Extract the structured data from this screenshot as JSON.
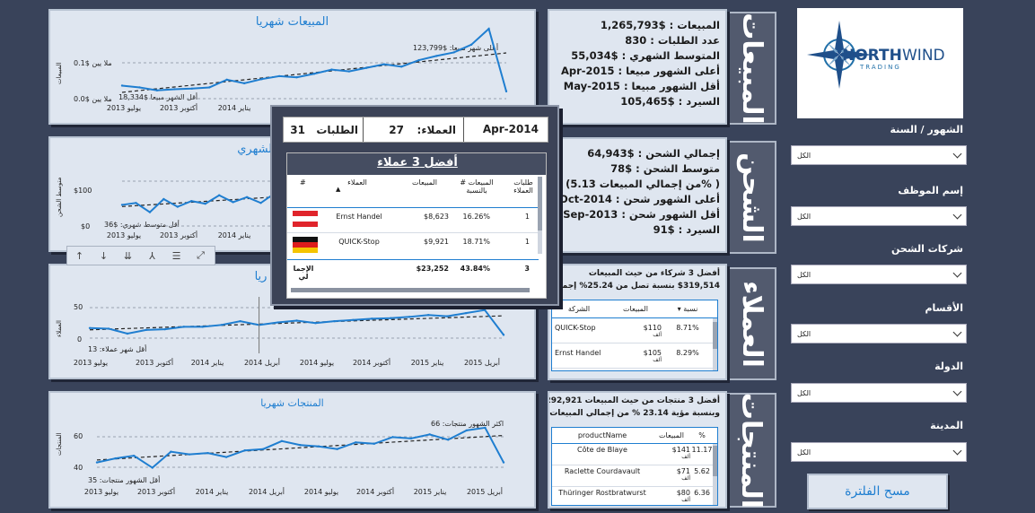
{
  "logo": {
    "brand_left": "NORTH",
    "brand_right": "WIND",
    "brand_sub": "TRADING"
  },
  "filters": [
    {
      "label": "الشهور / السنة",
      "value": "الكل"
    },
    {
      "label": "إسم الموظف",
      "value": "الكل"
    },
    {
      "label": "شركات الشحن",
      "value": "الكل"
    },
    {
      "label": "الأقسام",
      "value": "الكل"
    },
    {
      "label": "الدولة",
      "value": "الكل"
    },
    {
      "label": "المدينة",
      "value": "الكل"
    }
  ],
  "clear_button": "مسح الفلترة",
  "section_labels": [
    "المبيعات",
    "الشحن",
    "العملاء",
    "المنتجات"
  ],
  "sales_kpis": [
    "المبيعات : $1,265,793",
    "عدد الطلبات : 830",
    "المتوسط الشهري : $55,034",
    "أعلى الشهور مبيعا : Apr-2015",
    "أقل الشهور مبيعا : May-2015",
    "السيرد : $105,465"
  ],
  "shipping_kpis": [
    "إجمالي الشحن : $64,943",
    "متوسط الشحن : $78",
    "( %من إجمالي المبيعات 5.13)",
    "أعلى الشهور شحن : Oct-2014",
    "أقل الشهور شحن : Sep-2013",
    "السيرد : $91"
  ],
  "customers_block": {
    "line1": "أفضل 3 شركاء من حيث المبيعات",
    "line2": "$319,514 بنسبة تصل من 25.24% إجمالي",
    "headers": [
      "نسبة",
      "المبيعات",
      "الشركة"
    ],
    "rows": [
      {
        "pct": "8.71%",
        "sales": "$110",
        "unit": "ألف",
        "company": "QUICK-Stop"
      },
      {
        "pct": "8.29%",
        "sales": "$105",
        "unit": "ألف",
        "company": "Ernst Handel"
      }
    ]
  },
  "products_block": {
    "line1": "أفضل 3 منتجات من حيث المبيعات 292,921",
    "line2": "وبنسبة مؤية 23.14 % من إجمالي المبيعات",
    "headers": [
      "%",
      "المبيعات",
      "productName"
    ],
    "rows": [
      {
        "pct": "11.17",
        "sales": "$141",
        "unit": "ألف",
        "name": "Côte de Blaye"
      },
      {
        "pct": "5.62",
        "sales": "$71",
        "unit": "ألف",
        "name": "Raclette Courdavault"
      },
      {
        "pct": "6.36",
        "sales": "$80",
        "unit": "ألف",
        "name": "Thüringer Rostbratwurst"
      }
    ]
  },
  "x_ticks_chart1": [
    "يوليو 2013",
    "أكتوبر 2013",
    "يناير 2014"
  ],
  "x_ticks_full": [
    "يوليو 2013",
    "أكتوبر 2013",
    "يناير 2014",
    "أبريل 2014",
    "يوليو 2014",
    "أكتوبر 2014",
    "يناير 2015",
    "أبريل 2015"
  ],
  "x_ticks_chart2": [
    "يوليو 2013",
    "أكتوبر 2013",
    "يناير 2014"
  ],
  "charts": {
    "sales": {
      "title": "المبيعات شهريا",
      "ylabel": "المبيعات",
      "yticks": [
        "ملا يين $0.1",
        "ملا يين $0.0"
      ],
      "ann_max": "أعلى شهر مبيعا: $123,799",
      "ann_min": "أقل الشهر مبيعا $18,334"
    },
    "shipping": {
      "title": "الشهري",
      "ylabel": "متوسط الشحن",
      "yticks": [
        "$100",
        "$0"
      ],
      "ann_min": "أقل متوسط شهري: $36"
    },
    "customers": {
      "title": "ريا",
      "ylabel": "العملاء",
      "yticks": [
        "50",
        "0"
      ],
      "ann_min": "أقل شهر عملاء: 13"
    },
    "products": {
      "title": "المنتجات شهريا",
      "ylabel": "المنتجات",
      "yticks": [
        "60",
        "40"
      ],
      "ann_max": "اكثر الشهور منتجات: 66",
      "ann_min": "أقل الشهور منتجات: 35"
    }
  },
  "chart_data": [
    {
      "type": "line",
      "title": "المبيعات شهريا",
      "x": [
        "Jul-2013",
        "Aug-2013",
        "Sep-2013",
        "Oct-2013",
        "Nov-2013",
        "Dec-2013",
        "Jan-2014",
        "Feb-2014",
        "Mar-2014",
        "Apr-2014",
        "May-2014",
        "Jun-2014",
        "Jul-2014",
        "Aug-2014",
        "Sep-2014",
        "Oct-2014",
        "Nov-2014",
        "Dec-2014",
        "Jan-2015",
        "Feb-2015",
        "Mar-2015",
        "Apr-2015",
        "May-2015"
      ],
      "series": [
        {
          "values": [
            28000,
            25000,
            20000,
            22000,
            23000,
            25000,
            38000,
            32000,
            39000,
            44000,
            42000,
            48000,
            55000,
            52000,
            58000,
            64000,
            60000,
            71000,
            78000,
            84000,
            97000,
            123799,
            18334
          ]
        }
      ],
      "ylim": [
        0,
        130000
      ]
    },
    {
      "type": "line",
      "title": "الشهري",
      "x": [
        "Jul-2013",
        "Aug-2013",
        "Sep-2013",
        "Oct-2013",
        "Nov-2013",
        "Dec-2013",
        "Jan-2014",
        "Feb-2014",
        "Mar-2014",
        "Apr-2014",
        "May-2014",
        "Jun-2014"
      ],
      "series": [
        {
          "values": [
            55,
            60,
            36,
            70,
            50,
            65,
            58,
            80,
            62,
            75,
            60,
            85
          ]
        }
      ],
      "ylim": [
        0,
        140
      ]
    },
    {
      "type": "line",
      "title": "ريا",
      "x": [
        "Jul-2013",
        "Aug-2013",
        "Sep-2013",
        "Oct-2013",
        "Nov-2013",
        "Dec-2013",
        "Jan-2014",
        "Feb-2014",
        "Mar-2014",
        "Apr-2014",
        "May-2014",
        "Jun-2014",
        "Jul-2014",
        "Aug-2014",
        "Sep-2014",
        "Oct-2014",
        "Nov-2014",
        "Dec-2014",
        "Jan-2015",
        "Feb-2015",
        "Mar-2015",
        "Apr-2015",
        "May-2015"
      ],
      "series": [
        {
          "values": [
            22,
            21,
            13,
            19,
            20,
            24,
            24,
            27,
            33,
            27,
            31,
            34,
            30,
            33,
            35,
            37,
            38,
            40,
            43,
            41,
            46,
            51,
            11
          ]
        }
      ],
      "ylim": [
        0,
        65
      ]
    },
    {
      "type": "line",
      "title": "المنتجات شهريا",
      "x": [
        "Jul-2013",
        "Aug-2013",
        "Sep-2013",
        "Oct-2013",
        "Nov-2013",
        "Dec-2013",
        "Jan-2014",
        "Feb-2014",
        "Mar-2014",
        "Apr-2014",
        "May-2014",
        "Jun-2014",
        "Jul-2014",
        "Aug-2014",
        "Sep-2014",
        "Oct-2014",
        "Nov-2014",
        "Dec-2014",
        "Jan-2015",
        "Feb-2015",
        "Mar-2015",
        "Apr-2015",
        "May-2015"
      ],
      "series": [
        {
          "values": [
            40,
            43,
            45,
            36,
            48,
            46,
            47,
            44,
            49,
            50,
            56,
            53,
            52,
            50,
            55,
            54,
            59,
            58,
            61,
            57,
            64,
            66,
            40
          ]
        }
      ],
      "ylim": [
        33,
        72
      ]
    }
  ],
  "tooltip": {
    "month": "Apr-2014",
    "customers_label": "العملاء:",
    "customers_value": "27",
    "orders_label": "الطلبات",
    "orders_value": "31",
    "table_title": "أفضل 3 عملاء",
    "headers": [
      "طلبات العملاء",
      "المبيعات # بالنسبة",
      "المبيعات",
      "العملاء",
      "#"
    ],
    "rows": [
      {
        "orders": "1",
        "pct": "16.26%",
        "sales": "$8,623",
        "customer": "Ernst Handel",
        "flag": "austria"
      },
      {
        "orders": "1",
        "pct": "18.71%",
        "sales": "$9,921",
        "customer": "QUICK-Stop",
        "flag": "germany"
      }
    ],
    "total": {
      "label": "الإجما لي",
      "sales": "$23,252",
      "pct": "43.84%",
      "orders": "3"
    }
  },
  "colors": {
    "background": "#39435a",
    "panel": "#dfe6f0",
    "accent": "#1f7ed0",
    "side_label": "#525a6e"
  }
}
